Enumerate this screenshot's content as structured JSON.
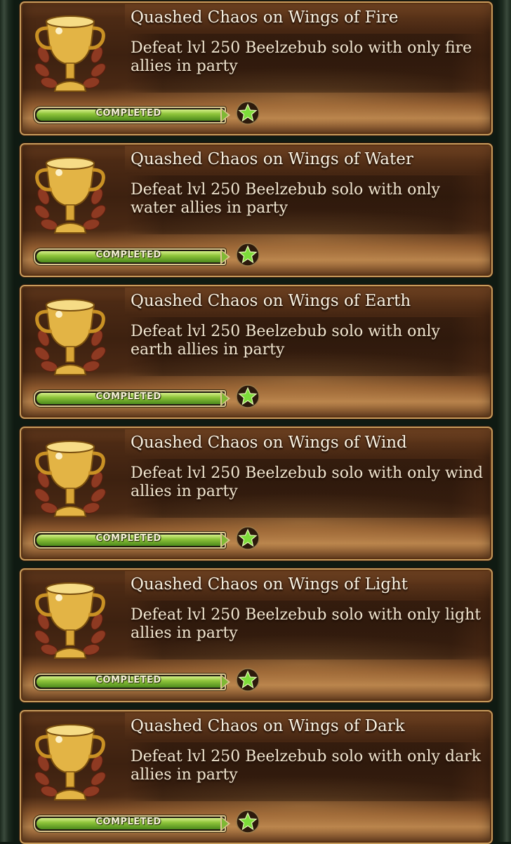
{
  "achievements": [
    {
      "title": "Quashed Chaos on Wings of Fire",
      "description": "Defeat lvl 250 Beelzebub solo with only fire allies in party",
      "status": "COMPLETED",
      "progress": 1.0
    },
    {
      "title": "Quashed Chaos on Wings of Water",
      "description": "Defeat lvl 250 Beelzebub solo with only water allies in party",
      "status": "COMPLETED",
      "progress": 1.0
    },
    {
      "title": "Quashed Chaos on Wings of Earth",
      "description": "Defeat lvl 250 Beelzebub solo with only earth allies in party",
      "status": "COMPLETED",
      "progress": 1.0
    },
    {
      "title": "Quashed Chaos on Wings of Wind",
      "description": "Defeat lvl 250 Beelzebub solo with only wind allies in party",
      "status": "COMPLETED",
      "progress": 1.0
    },
    {
      "title": "Quashed Chaos on Wings of Light",
      "description": "Defeat lvl 250 Beelzebub solo with only light allies in party",
      "status": "COMPLETED",
      "progress": 1.0
    },
    {
      "title": "Quashed Chaos on Wings of Dark",
      "description": "Defeat lvl 250 Beelzebub solo with only dark allies in party",
      "status": "COMPLETED",
      "progress": 1.0
    }
  ],
  "icons": {
    "trophy": "trophy-icon",
    "star": "star-icon"
  },
  "colors": {
    "progress_fill": "#8ec43a",
    "card_border": "#c79b5b",
    "star": "#7ddc3a"
  }
}
